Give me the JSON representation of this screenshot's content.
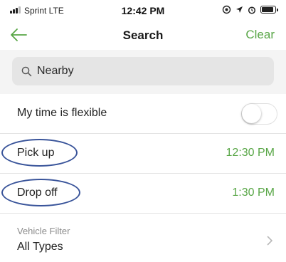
{
  "status_bar": {
    "carrier": "Sprint  LTE",
    "time": "12:42 PM",
    "icons": [
      "location-icon",
      "arrow-icon",
      "alarm-icon"
    ],
    "battery_level": 0.9
  },
  "nav": {
    "title": "Search",
    "back_icon": "arrow-left-icon",
    "clear_label": "Clear",
    "accent_color": "#58a646"
  },
  "search": {
    "value": "Nearby",
    "icon": "search-icon"
  },
  "flexible": {
    "label": "My time is flexible",
    "enabled": false
  },
  "pickup": {
    "label": "Pick up",
    "time": "12:30 PM"
  },
  "dropoff": {
    "label": "Drop off",
    "time": "1:30 PM"
  },
  "vehicle_filter": {
    "label": "Vehicle Filter",
    "value": "All Types"
  },
  "annotation_color": "#39549a"
}
